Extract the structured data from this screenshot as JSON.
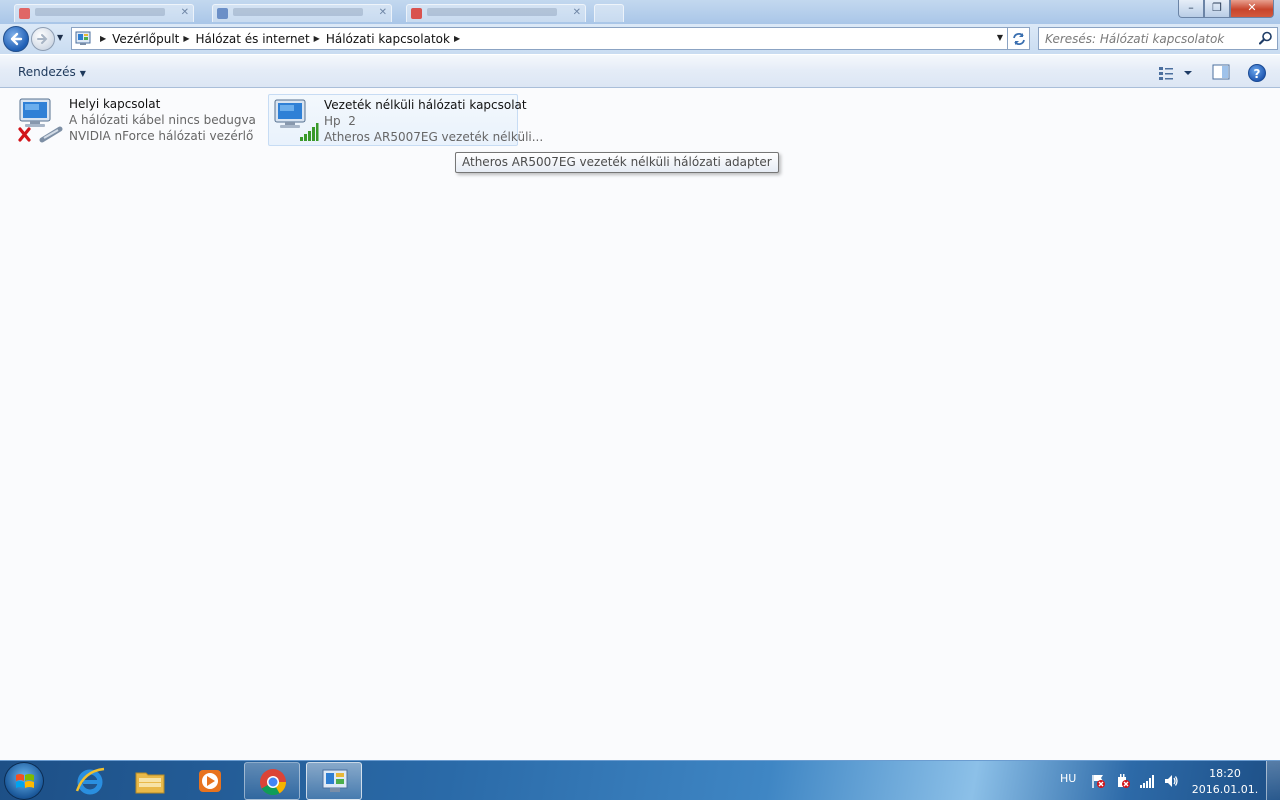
{
  "window": {
    "minimize_label": "–",
    "maximize_label": "❐",
    "close_label": "✕"
  },
  "nav": {
    "breadcrumbs": [
      "Vezérlőpult",
      "Hálózat és internet",
      "Hálózati kapcsolatok"
    ],
    "search_placeholder": "Keresés: Hálózati kapcsolatok"
  },
  "toolbar": {
    "organize_label": "Rendezés",
    "help_label": "?"
  },
  "connections": [
    {
      "name": "Helyi kapcsolat",
      "status": "A hálózati kábel nincs bedugva",
      "device": "NVIDIA nForce hálózati vezérlő",
      "icon": "wired-network-disconnected-icon"
    },
    {
      "name": "Vezeték nélküli hálózati kapcsolat",
      "status": "Hp  2",
      "device": "Atheros AR5007EG vezeték nélküli...",
      "icon": "wireless-network-signal-icon"
    }
  ],
  "tooltip": {
    "text": "Atheros AR5007EG vezeték nélküli hálózati adapter"
  },
  "taskbar": {
    "items": [
      "start-orb",
      "internet-explorer",
      "windows-explorer",
      "media-player",
      "chrome",
      "network-connections"
    ],
    "language": "HU",
    "time": "18:20",
    "date": "2016.01.01."
  },
  "colors": {
    "accent": "#1f5fb5",
    "close": "#c8452c",
    "error_x": "#d2141a",
    "signal": "#3a9a2a"
  }
}
